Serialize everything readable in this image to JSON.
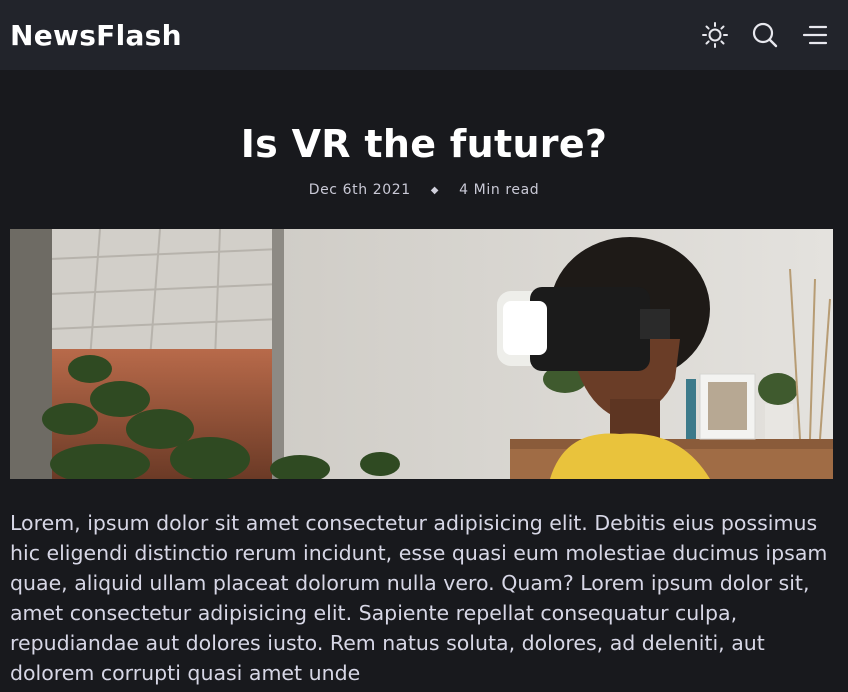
{
  "app": {
    "brand": "NewsFlash"
  },
  "header": {
    "icons": [
      "sun-icon",
      "search-icon",
      "menu-icon"
    ]
  },
  "article": {
    "title": "Is VR the future?",
    "date": "Dec 6th 2021",
    "separator": "◆",
    "read_time": "4 Min read",
    "body": "Lorem, ipsum dolor sit amet consectetur adipisicing elit. Debitis eius possimus hic eligendi distinctio rerum incidunt, esse quasi eum molestiae ducimus ipsam quae, aliquid ullam placeat dolorum nulla vero. Quam? Lorem ipsum dolor sit, amet consectetur adipisicing elit. Sapiente repellat consequatur culpa, repudiandae aut dolores iusto. Rem natus soluta, dolores, ad deleniti, aut dolorem corrupti quasi amet unde"
  },
  "colors": {
    "background": "#18191d",
    "header": "#22242b",
    "text": "#ffffff",
    "muted": "#c9c9d6"
  }
}
